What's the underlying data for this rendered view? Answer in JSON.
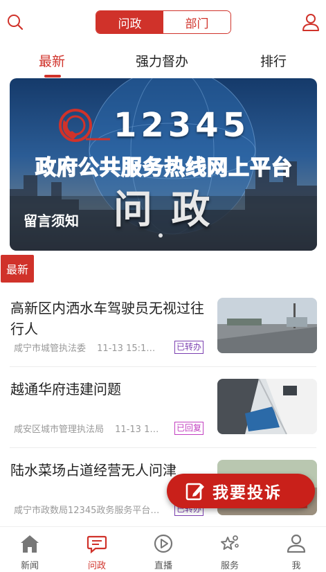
{
  "header": {
    "segments": [
      "问政",
      "部门"
    ],
    "active_segment": 0
  },
  "subtabs": [
    "最新",
    "强力督办",
    "排行"
  ],
  "banner": {
    "caption": "留言须知",
    "number": "12345",
    "headline": "政府公共服务热线网上平台",
    "big_text": "问 政"
  },
  "latest_tag": "最新",
  "news": [
    {
      "title": "高新区内洒水车驾驶员无视过往行人",
      "source": "咸宁市城管执法委",
      "time": "11-13  15:1…",
      "status": "已转办",
      "status_color": "#7b3fb0"
    },
    {
      "title": "越通华府违建问题",
      "source": "咸安区城市管理执法局",
      "time": "11-13  1…",
      "status": "已回复",
      "status_color": "#c23ec0"
    },
    {
      "title": "陆水菜场占道经营无人问津",
      "source": "咸宁市政数局12345政务服务平台…",
      "time": "",
      "status": "已转办",
      "status_color": "#7b3fb0"
    }
  ],
  "complain_button": "我要投诉",
  "bottom_nav": [
    "新闻",
    "问政",
    "直播",
    "服务",
    "我"
  ],
  "bottom_nav_active": 1,
  "colors": {
    "accent": "#d0322a",
    "status_forwarded": "#7b3fb0",
    "status_replied": "#c23ec0"
  }
}
